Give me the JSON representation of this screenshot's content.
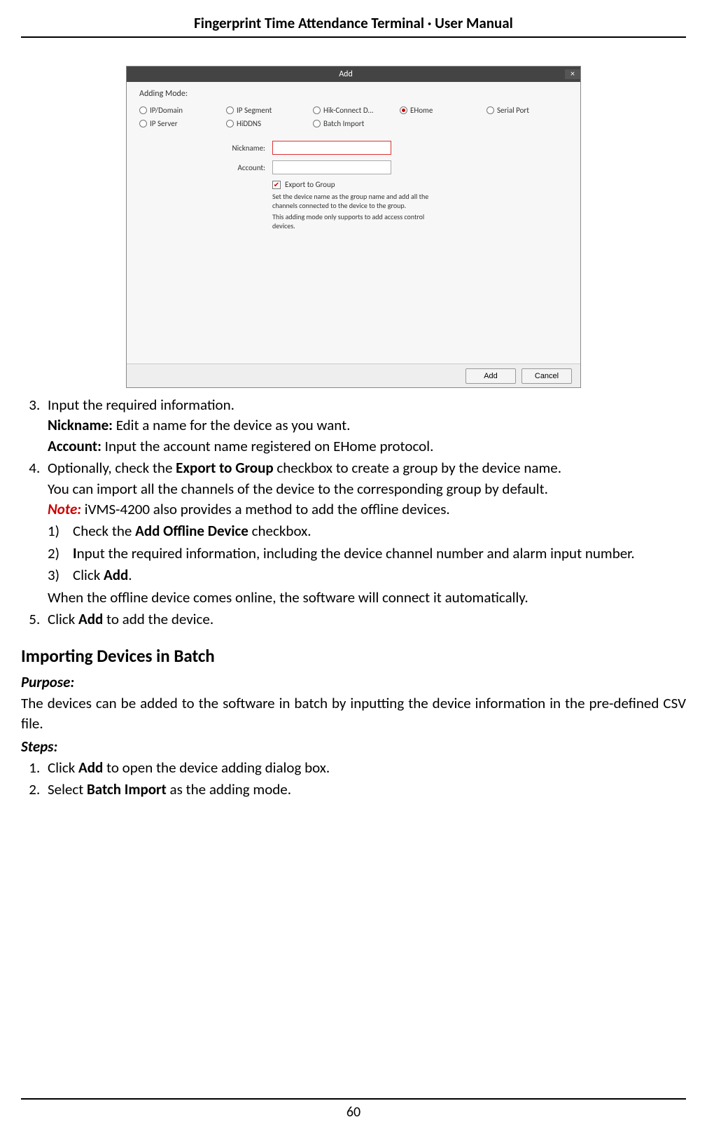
{
  "doc_title": "Fingerprint Time Attendance Terminal · User Manual",
  "page_number": "60",
  "dialog": {
    "title": "Add",
    "close": "×",
    "mode_label": "Adding Mode:",
    "radios": {
      "ip_domain": "IP/Domain",
      "ip_segment": "IP Segment",
      "hik_connect": "Hik-Connect D...",
      "ehome": "EHome",
      "serial_port": "Serial Port",
      "ip_server": "IP Server",
      "hiddns": "HiDDNS",
      "batch_import": "Batch Import"
    },
    "nickname_label": "Nickname:",
    "nickname_value": "",
    "account_label": "Account:",
    "account_value": "",
    "export_checkbox": "Export to Group",
    "helper1": "Set the device name as the group name and add all the channels connected to the device to the group.",
    "helper2": "This adding mode only supports to add access control devices.",
    "add_btn": "Add",
    "cancel_btn": "Cancel"
  },
  "body": {
    "step3": "Input the required information.",
    "nickname_bold": "Nickname:",
    "nickname_desc": " Edit a name for the device as you want.",
    "account_bold": "Account:",
    "account_desc": " Input the account name registered on EHome protocol.",
    "step4_a": "Optionally, check the ",
    "step4_b": "Export to Group",
    "step4_c": " checkbox to create a group by the device name.",
    "step4_line2": "You can import all the channels of the device to the corresponding group by default.",
    "note_label": "Note:",
    "note_text": " iVMS-4200 also provides a method to add the offline devices.",
    "sub1_a": "Check the ",
    "sub1_b": "Add Offline Device",
    "sub1_c": " checkbox.",
    "sub2_a": "I",
    "sub2_b": "nput the required information, including the device channel number and alarm input number.",
    "sub3_a": "Click ",
    "sub3_b": "Add",
    "sub3_c": ".",
    "step4_tail": "When the offline device comes online, the software will connect it automatically.",
    "step5_a": "Click ",
    "step5_b": "Add",
    "step5_c": " to add the device.",
    "section_title": "Importing Devices in Batch",
    "purpose_label": "Purpose:",
    "purpose_text": "The devices can be added to the software in batch by inputting the device information in the pre-defined CSV file.",
    "steps_label": "Steps:",
    "bstep1_a": "Click ",
    "bstep1_b": "Add",
    "bstep1_c": " to open the device adding dialog box.",
    "bstep2_a": "Select ",
    "bstep2_b": "Batch Import",
    "bstep2_c": " as the adding mode."
  }
}
